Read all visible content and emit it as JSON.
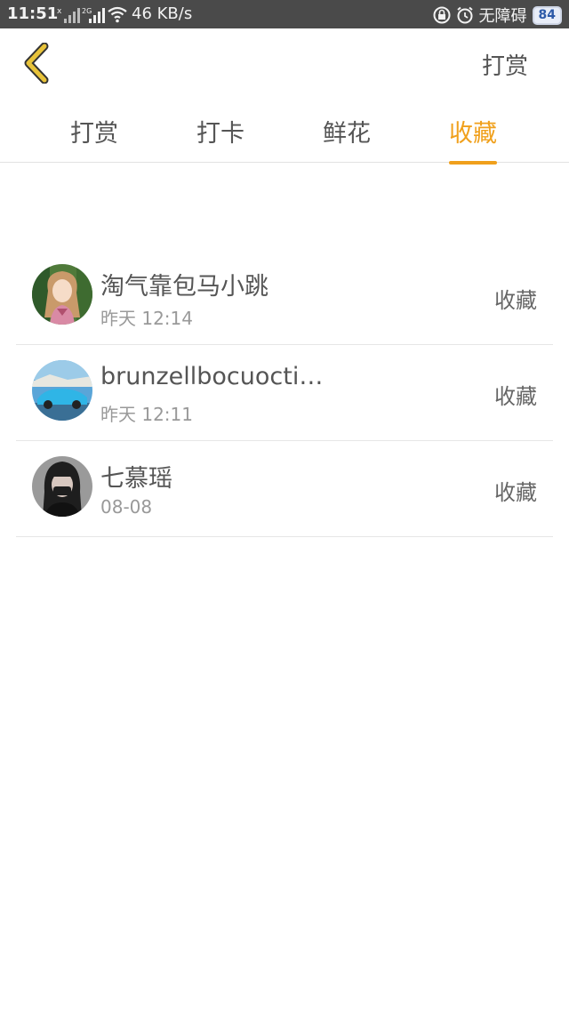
{
  "status_bar": {
    "time": "11:51",
    "speed": "46 KB/s",
    "accessibility": "无障碍",
    "battery": "84"
  },
  "header": {
    "action_label": "打赏"
  },
  "tabs": [
    {
      "label": "打赏",
      "active": false
    },
    {
      "label": "打卡",
      "active": false
    },
    {
      "label": "鲜花",
      "active": false
    },
    {
      "label": "收藏",
      "active": true
    }
  ],
  "colors": {
    "accent": "#f0a01c",
    "back_icon": "#e8c33a",
    "status_bar": "#4a4a4a"
  },
  "records": [
    {
      "name": "淘气靠包马小跳",
      "time": "昨天 12:14",
      "action": "收藏"
    },
    {
      "name": "brunzellbocuoctin...",
      "time": "昨天 12:11",
      "action": "收藏"
    },
    {
      "name": "七慕瑶",
      "time": "08-08",
      "action": "收藏"
    }
  ]
}
